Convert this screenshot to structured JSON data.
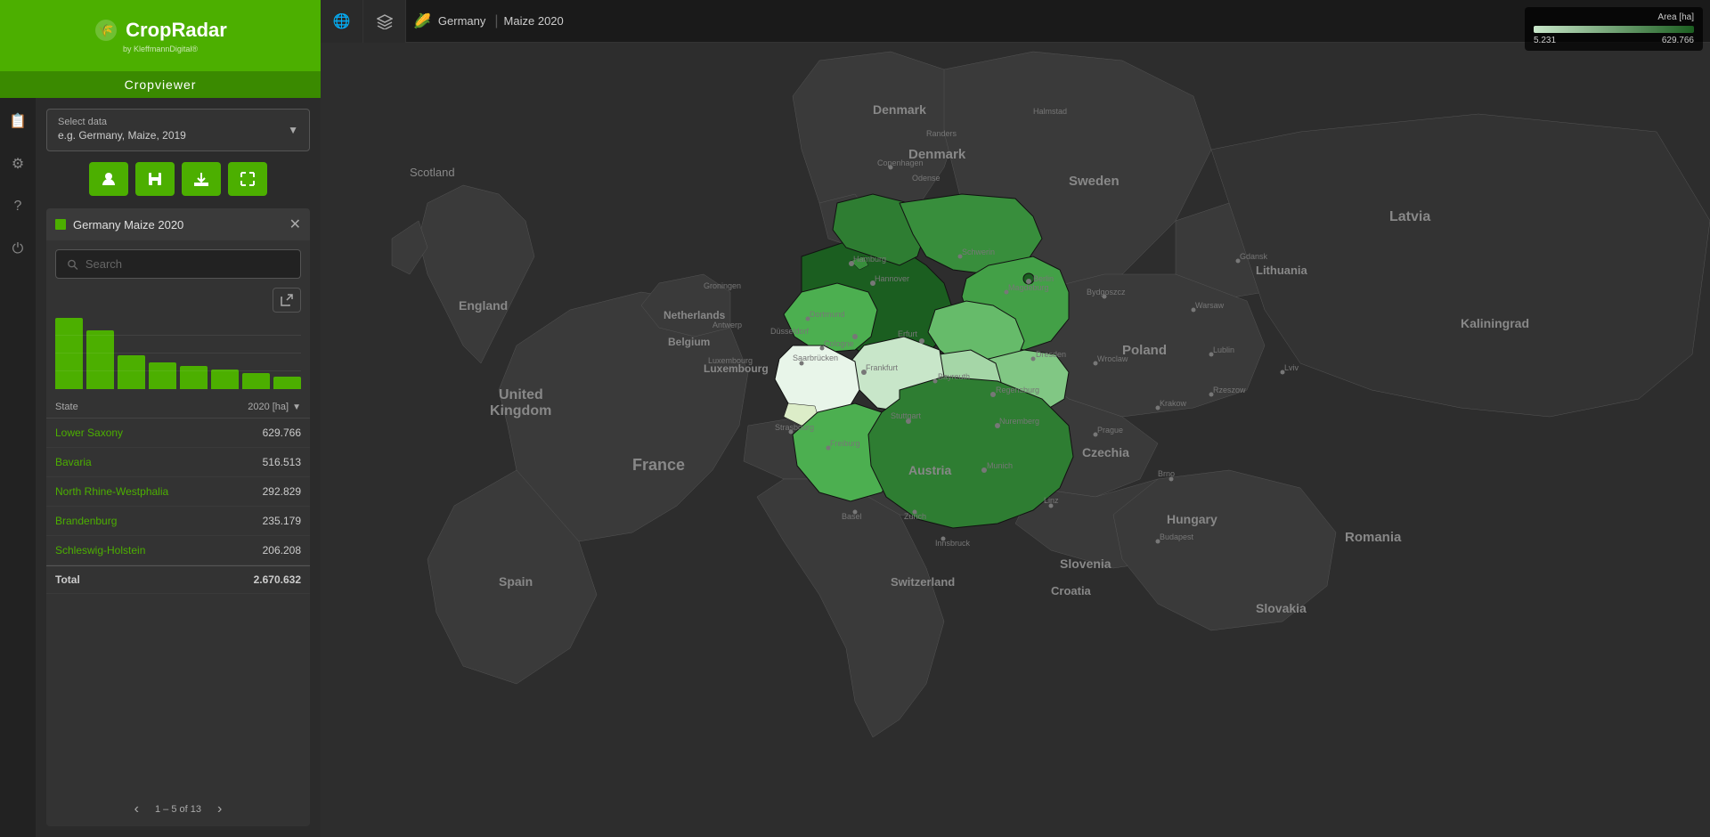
{
  "app": {
    "logo_text": "CropRadar",
    "logo_sub": "by KleffmannDigital®",
    "cropviewer_label": "Cropviewer"
  },
  "sidebar": {
    "select_data_label": "Select data",
    "select_data_placeholder": "e.g. Germany, Maize, 2019",
    "action_buttons": [
      {
        "name": "user-btn",
        "icon": "👤"
      },
      {
        "name": "save-btn",
        "icon": "💾"
      },
      {
        "name": "download-btn",
        "icon": "⬇"
      },
      {
        "name": "fullscreen-btn",
        "icon": "⊞"
      }
    ],
    "dataset_title": "Germany Maize 2020",
    "search_placeholder": "Search",
    "export_icon": "↗",
    "chart": {
      "bars": [
        100,
        82,
        47,
        38,
        33,
        28,
        22,
        18
      ]
    },
    "table": {
      "col1": "State",
      "col2": "2020 [ha]",
      "rows": [
        {
          "name": "Lower Saxony",
          "value": "629.766"
        },
        {
          "name": "Bavaria",
          "value": "516.513"
        },
        {
          "name": "North Rhine-Westphalia",
          "value": "292.829"
        },
        {
          "name": "Brandenburg",
          "value": "235.179"
        },
        {
          "name": "Schleswig-Holstein",
          "value": "206.208"
        }
      ],
      "total_label": "Total",
      "total_value": "2.670.632",
      "pagination": "1 – 5 of 13"
    }
  },
  "header": {
    "globe_icon": "🌐",
    "layers_icon": "⊞",
    "crop_icon": "🌽",
    "country": "Germany",
    "separator": "|",
    "crop_year": "Maize 2020"
  },
  "legend": {
    "title": "Area [ha]",
    "min": "5.231",
    "max": "629.766"
  },
  "nav_icons": [
    "📋",
    "⚙",
    "?",
    "⏻"
  ]
}
